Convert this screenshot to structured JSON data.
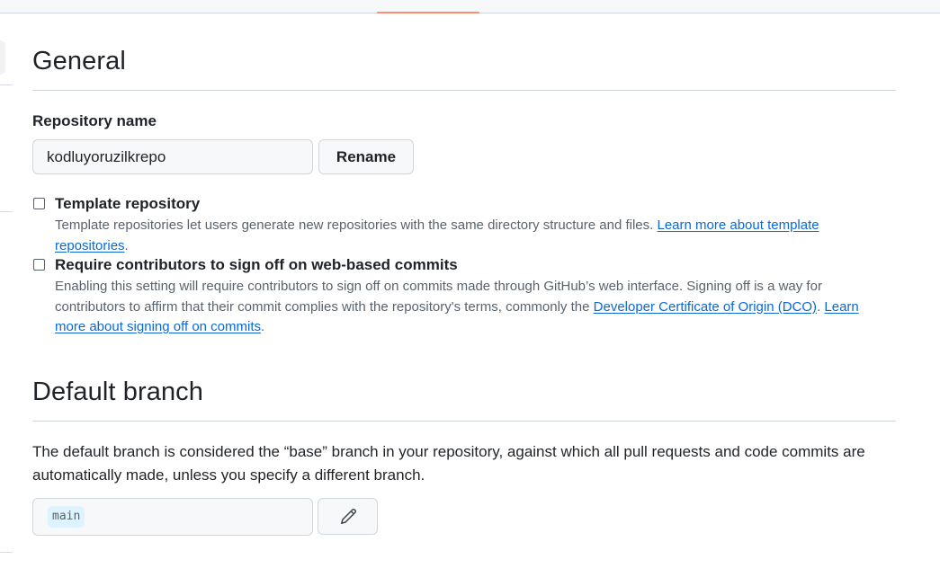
{
  "general": {
    "title": "General",
    "repo_name_label": "Repository name",
    "repo_name_value": "kodluyoruzilkrepo",
    "rename_button": "Rename"
  },
  "template_repository": {
    "label": "Template repository",
    "checked": false,
    "description": "Template repositories let users generate new repositories with the same directory structure and files.",
    "link_text": "Learn more about template repositories",
    "trailing": "."
  },
  "sign_off": {
    "label": "Require contributors to sign off on web-based commits",
    "checked": false,
    "description": "Enabling this setting will require contributors to sign off on commits made through GitHub’s web interface. Signing off is a way for contributors to affirm that their commit complies with the repository's terms, commonly the",
    "dco_link": "Developer Certificate of Origin (DCO)",
    "separator": ".",
    "learn_link": "Learn more about signing off on commits",
    "trailing": "."
  },
  "default_branch": {
    "title": "Default branch",
    "description": "The default branch is considered the “base” branch in your repository, against which all pull requests and code commits are automatically made, unless you specify a different branch.",
    "branch": "main",
    "edit_icon": "pencil-icon"
  },
  "colors": {
    "accent": "#0969da",
    "tab_underline": "#fd8c73",
    "branch_pill": "#ddf4ff"
  }
}
